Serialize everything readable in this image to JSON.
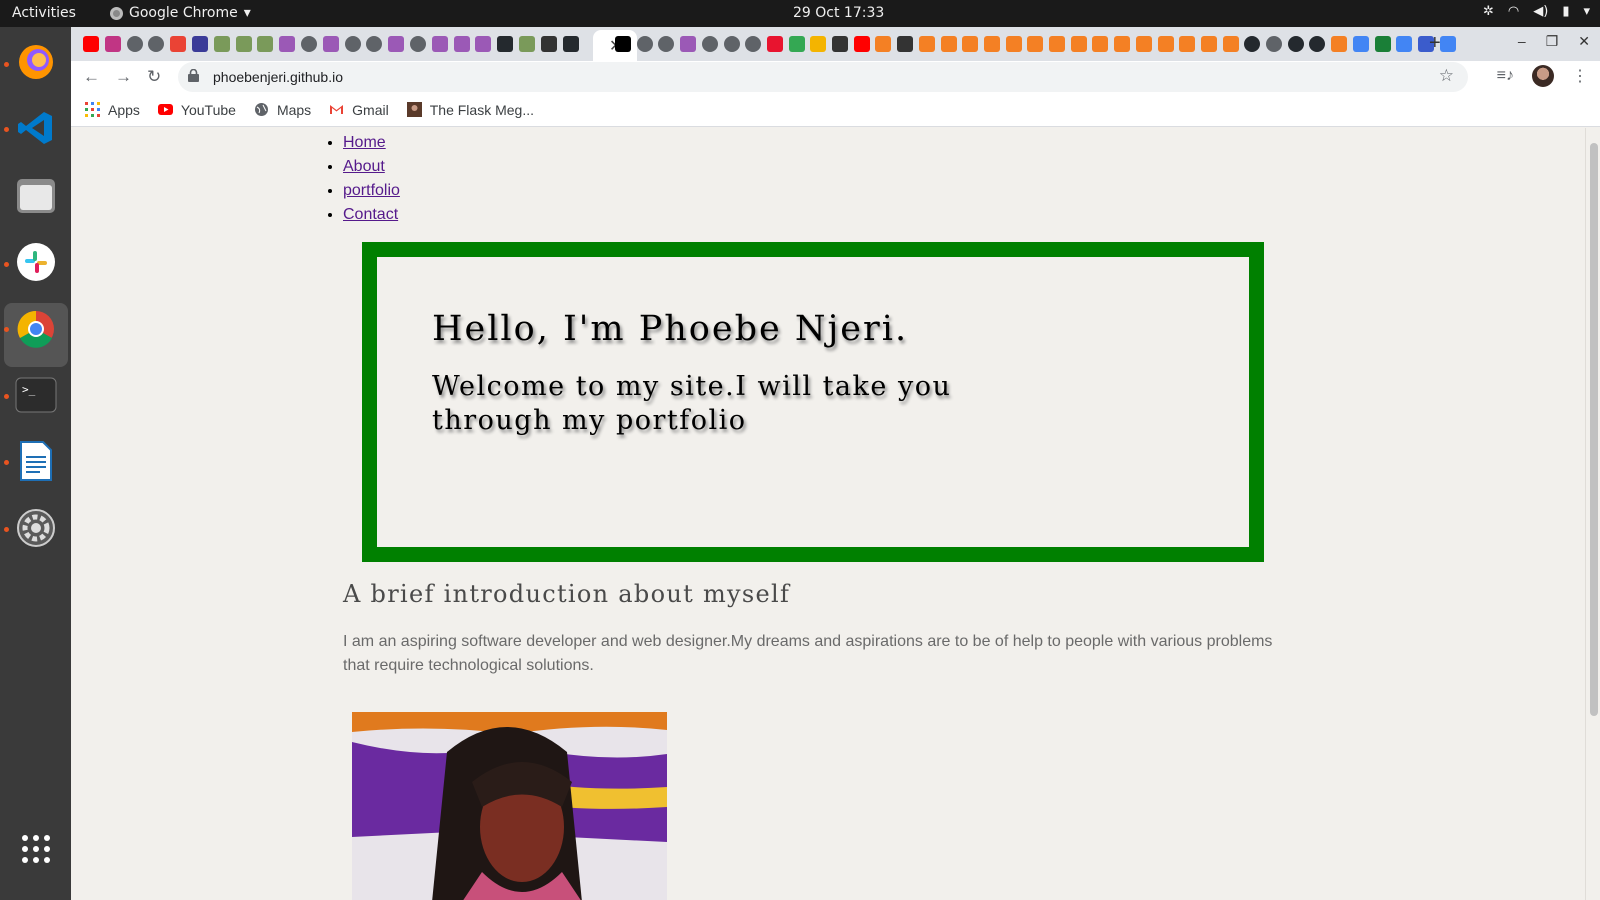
{
  "desktop": {
    "activities": "Activities",
    "app_name": "Google Chrome",
    "clock": "29 Oct  17:33"
  },
  "dock": {
    "apps": [
      "firefox-icon",
      "vscode-icon",
      "files-icon",
      "slack-icon",
      "chrome-icon",
      "terminal-icon",
      "writer-icon",
      "settings-icon",
      "app-grid-icon"
    ]
  },
  "browser": {
    "url": "phoebenjeri.github.io",
    "bookmarks": [
      {
        "label": "Apps",
        "icon": "apps-grid-icon"
      },
      {
        "label": "YouTube",
        "icon": "youtube-icon"
      },
      {
        "label": "Maps",
        "icon": "globe-icon"
      },
      {
        "label": "Gmail",
        "icon": "gmail-icon"
      },
      {
        "label": "The Flask Meg...",
        "icon": "bookmark-thumbnail-icon"
      }
    ]
  },
  "page": {
    "nav": [
      "Home",
      "About",
      "portfolio",
      "Contact"
    ],
    "hero_title": "Hello, I'm Phoebe Njeri.",
    "hero_subtitle": "Welcome to my site.I will take you through my portfolio",
    "intro_heading": "A brief introduction about myself",
    "intro_text": "I am an aspiring software developer and web designer.My dreams and aspirations are to be of help to people with various problems that require technological solutions.",
    "colors": {
      "hero_border": "#008000",
      "page_bg": "#f2f0ec",
      "link": "#551a8b"
    }
  }
}
